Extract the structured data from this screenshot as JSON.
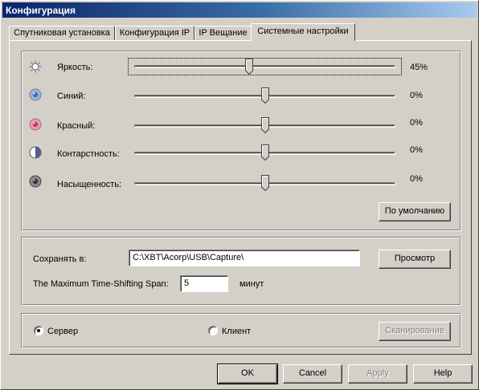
{
  "window": {
    "title": "Конфигурация"
  },
  "tabs": [
    {
      "label": "Спутниковая установка"
    },
    {
      "label": "Конфигурация IP"
    },
    {
      "label": "IP Вещание"
    },
    {
      "label": "Системные настройки"
    }
  ],
  "sliders": [
    {
      "label": "Яркость:",
      "value_text": "45%",
      "icon": "brightness-icon"
    },
    {
      "label": "Синий:",
      "value_text": "0%",
      "icon": "blue-icon"
    },
    {
      "label": "Красный:",
      "value_text": "0%",
      "icon": "red-icon"
    },
    {
      "label": "Контарстность:",
      "value_text": "0%",
      "icon": "contrast-icon"
    },
    {
      "label": "Насыщенность:",
      "value_text": "0%",
      "icon": "saturation-icon"
    }
  ],
  "defaults_button": "По умолчанию",
  "save": {
    "label": "Сохранять в:",
    "path": "C:\\XBT\\Acorp\\USB\\Capture\\",
    "browse_button": "Просмотр",
    "timeshift_label": "The Maximum Time-Shifting Span:",
    "timeshift_value": "5",
    "timeshift_unit": "минут"
  },
  "mode": {
    "server_label": "Сервер",
    "client_label": "Клиент",
    "selected": "Сервер",
    "scan_button": "Сканирование"
  },
  "footer": {
    "ok": "OK",
    "cancel": "Cancel",
    "apply": "Apply",
    "help": "Help"
  }
}
